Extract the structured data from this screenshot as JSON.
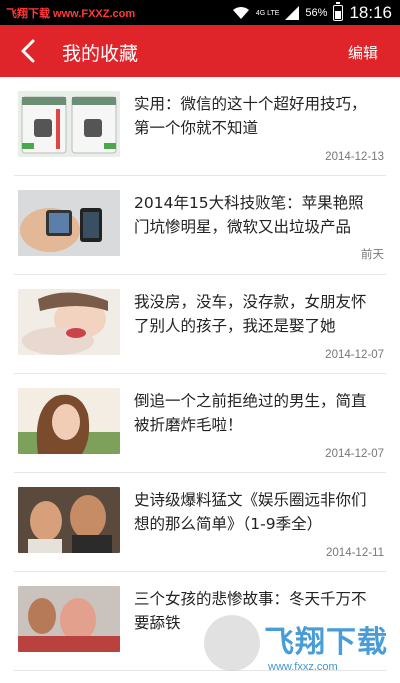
{
  "status_bar": {
    "brand": "飞翔下载 www.FXXZ.com",
    "network": "4G LTE",
    "battery_percent": "56%",
    "battery_level": 0.56,
    "time": "18:16"
  },
  "header": {
    "title": "我的收藏",
    "edit_label": "编辑",
    "back_icon": "back-arrow-icon"
  },
  "favorites": [
    {
      "title": "实用：微信的这十个超好用技巧，第一个你就不知道",
      "date": "2014-12-13"
    },
    {
      "title": "2014年15大科技败笔：苹果艳照门坑惨明星，微软又出垃圾产品",
      "date": "前天"
    },
    {
      "title": "我没房，没车，没存款，女朋友怀了别人的孩子，我还是娶了她",
      "date": "2014-12-07"
    },
    {
      "title": "倒追一个之前拒绝过的男生，简直被折磨炸毛啦！",
      "date": "2014-12-07"
    },
    {
      "title": "史诗级爆料猛文《娱乐圈远非你们想的那么简单》（1-9季全）",
      "date": "2014-12-11"
    },
    {
      "title": "三个女孩的悲惨故事：冬天千万不要舔铁",
      "date": ""
    }
  ],
  "watermark": {
    "text": "飞翔下载",
    "url": "www.fxxz.com"
  },
  "colors": {
    "header_bg": "#e0252a",
    "status_bg": "#000000",
    "divider": "#e6e6e6"
  }
}
